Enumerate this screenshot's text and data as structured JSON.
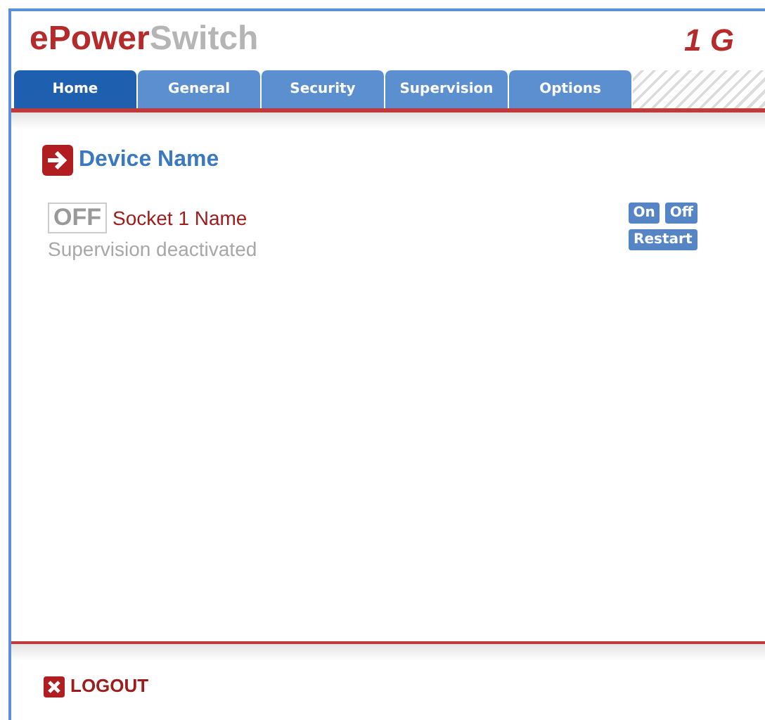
{
  "logo": {
    "part_1": "ePower",
    "part_2": "Switch"
  },
  "model": "1 G",
  "tabs": [
    {
      "label": "Home",
      "selected": true
    },
    {
      "label": "General",
      "selected": false
    },
    {
      "label": "Security",
      "selected": false
    },
    {
      "label": "Supervision",
      "selected": false
    },
    {
      "label": "Options",
      "selected": false
    }
  ],
  "device": {
    "title": "Device Name"
  },
  "sockets": [
    {
      "state": "OFF",
      "on": false,
      "name": "Socket 1 Name",
      "supervision": "Supervision deactivated",
      "buttons": [
        "On",
        "Off",
        "Restart"
      ]
    }
  ],
  "footer": {
    "logout": "LOGOUT"
  }
}
